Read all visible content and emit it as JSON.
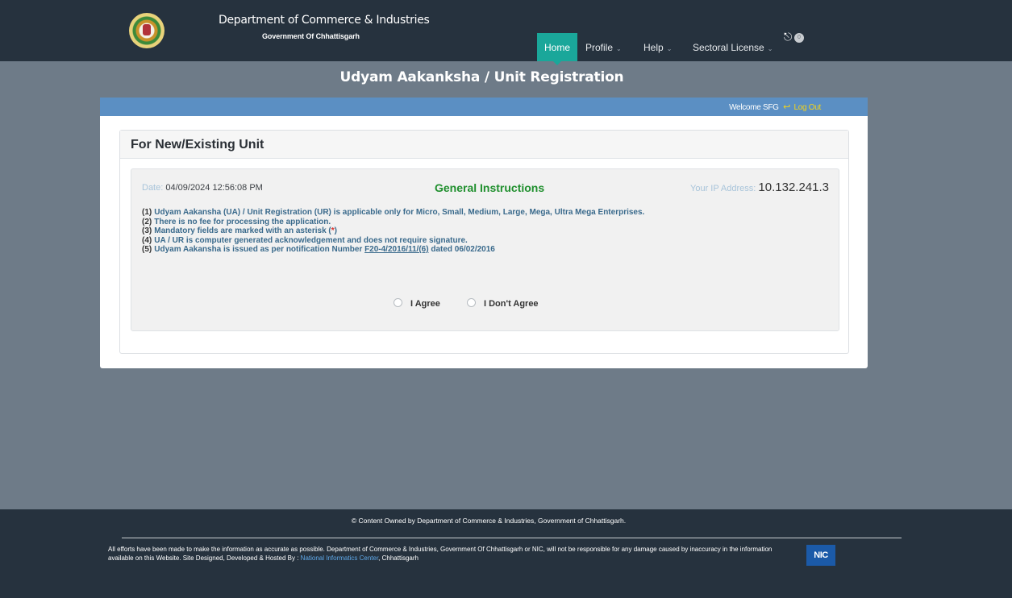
{
  "header": {
    "dept_title": "Department of Commerce & Industries",
    "dept_sub": "Government Of Chhattisgarh",
    "nav": {
      "home": "Home",
      "profile": "Profile",
      "help": "Help",
      "sectoral": "Sectoral License"
    },
    "notification_count": "0",
    "colors": {
      "bar": "#26323e",
      "active_nav": "#1aa79a"
    }
  },
  "page_title": "Udyam Aakanksha / Unit Registration",
  "session": {
    "welcome": "Welcome SFG",
    "logout": "Log Out"
  },
  "panel": {
    "title": "For New/Existing Unit",
    "date_label": "Date:",
    "date_value": "04/09/2024 12:56:08 PM",
    "instructions_title": "General Instructions",
    "ip_label": "Your IP Address:",
    "ip_value": "10.132.241.3",
    "instructions": [
      {
        "num": "(1)",
        "text": "Udyam Aakansha (UA) / Unit Registration (UR) is applicable only for Micro, Small, Medium, Large, Mega, Ultra Mega Enterprises."
      },
      {
        "num": "(2)",
        "text": "There is no fee for processing the application."
      },
      {
        "num": "(3)",
        "text_before": "Mandatory fields are marked with an asterisk (",
        "asterisk": "*",
        "text_after": ")"
      },
      {
        "num": "(4)",
        "text": "UA / UR is computer generated acknowledgement and does not require signature."
      },
      {
        "num": "(5)",
        "text_before": "Udyam Aakansha is issued as per notification Number ",
        "link": "F20-4/2016/11/(6)",
        "text_after": " dated 06/02/2016"
      }
    ],
    "agree_label": "I Agree",
    "disagree_label": "I Don't Agree"
  },
  "footer": {
    "copyright": "© Content Owned by Department of Commerce & Industries, Government of Chhattisgarh.",
    "disclaimer_1": "All efforts have been made to make the information as accurate as possible. Department of Commerce & Industries, Government Of Chhattisgarh or NIC, will not be responsible for any damage caused by inaccuracy in the information available on this Website. Site Designed, Developed & Hosted By :",
    "nic_link": "National Informatics Center",
    "disclaimer_2": ", Chhattisgarh",
    "nic_logo": "NIC"
  }
}
